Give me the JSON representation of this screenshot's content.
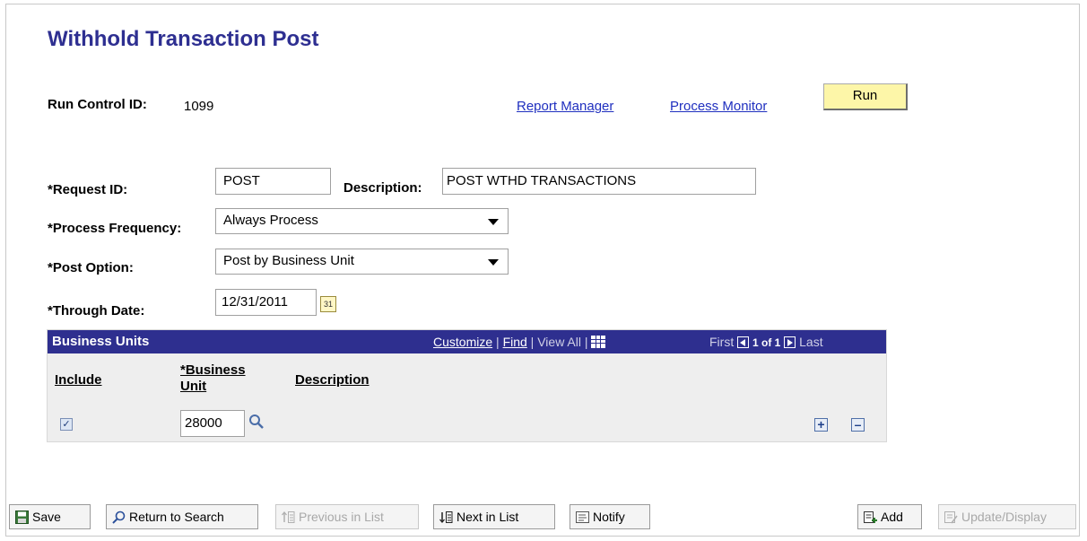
{
  "page": {
    "title": "Withhold Transaction Post"
  },
  "run_control": {
    "label": "Run Control ID:",
    "value": "1099"
  },
  "header_links": {
    "report_manager": "Report Manager",
    "process_monitor": "Process Monitor",
    "run": "Run"
  },
  "form": {
    "request_id_label": "*Request ID:",
    "request_id_value": "POST",
    "description_label": "Description:",
    "description_value": "POST WTHD TRANSACTIONS",
    "process_frequency_label": "*Process Frequency:",
    "process_frequency_value": "Always Process",
    "post_option_label": "*Post Option:",
    "post_option_value": "Post by Business Unit",
    "through_date_label": "*Through Date:",
    "through_date_value": "12/31/2011"
  },
  "grid": {
    "title": "Business Units",
    "customize": "Customize",
    "sep1": " | ",
    "find": "Find",
    "view_all": " | View All | ",
    "first": "First",
    "count": "1 of 1",
    "last": "Last",
    "col_include": "Include",
    "col_bu_line1": "*Business",
    "col_bu_line2": "Unit",
    "col_description": "Description",
    "row": {
      "include_checked": true,
      "business_unit": "28000",
      "description": ""
    }
  },
  "toolbar": {
    "save": "Save",
    "return_to_search": "Return to Search",
    "previous_in_list": "Previous in List",
    "next_in_list": "Next in List",
    "notify": "Notify",
    "add": "Add",
    "update_display": "Update/Display"
  },
  "colors": {
    "title": "#2e2f91",
    "grid_header": "#2e2f8f",
    "link": "#1f2fbf",
    "run_button": "#fdf6a8"
  }
}
